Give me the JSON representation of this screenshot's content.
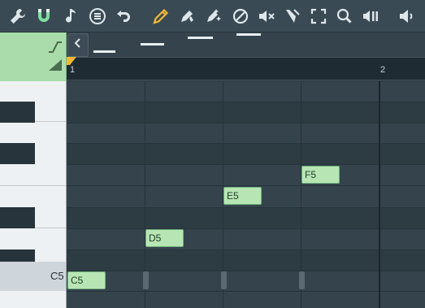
{
  "toolbar": {
    "icons": [
      "wrench-icon",
      "magnet-icon",
      "note-icon",
      "menu-icon",
      "undo-icon",
      "pencil-icon",
      "paint-icon",
      "brush-icon",
      "delete-icon",
      "mute-icon",
      "slice-icon",
      "select-icon",
      "zoom-icon",
      "playback-icon",
      "speaker-icon"
    ],
    "accent": "#f4b63a",
    "magnet_color": "#7fe0a0"
  },
  "timeline": {
    "bars": [
      "1",
      "2"
    ]
  },
  "keyboard": {
    "c5_label": "C5"
  },
  "notes": [
    {
      "label": "C5",
      "bar_position": 1.0
    },
    {
      "label": "D5",
      "bar_position": 1.25
    },
    {
      "label": "E5",
      "bar_position": 1.5
    },
    {
      "label": "F5",
      "bar_position": 1.75
    }
  ]
}
